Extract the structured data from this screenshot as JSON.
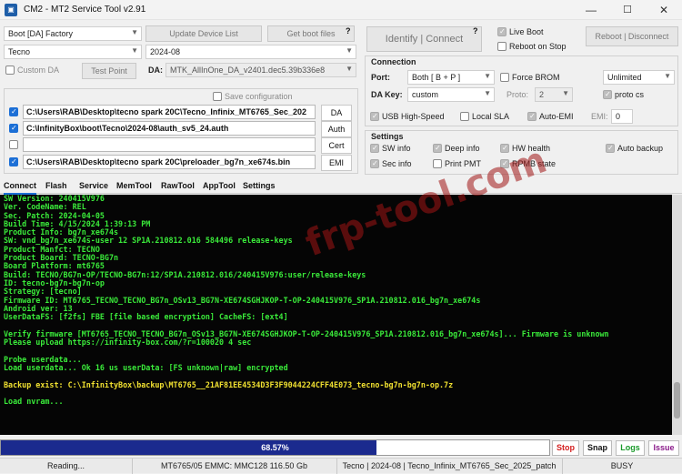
{
  "window": {
    "title": "CM2 - MT2 Service Tool v2.91",
    "min": "—",
    "max": "☐",
    "close": "✕"
  },
  "left": {
    "boot_combo": "Boot [DA] Factory",
    "brand_combo": "Tecno",
    "date_combo": "2024-08",
    "update_btn": "Update Device List",
    "bootfiles_btn": "Get boot files",
    "custom_da_label": "Custom DA",
    "test_point_btn": "Test Point",
    "da_label": "DA:",
    "da_value": "MTK_AllInOne_DA_v2401.dec5.39b336e8",
    "save_config_label": "Save configuration",
    "files": [
      {
        "path": "C:\\Users\\RAB\\Desktop\\tecno spark 20C\\Tecno_Infinix_MT6765_Sec_202",
        "button": "DA",
        "checked": true
      },
      {
        "path": "C:\\InfinityBox\\boot\\Tecno\\2024-08\\auth_sv5_24.auth",
        "button": "Auth",
        "checked": true
      },
      {
        "path": "",
        "button": "Cert",
        "checked": false
      },
      {
        "path": "C:\\Users\\RAB\\Desktop\\tecno spark 20C\\preloader_bg7n_xe674s.bin",
        "button": "EMI",
        "checked": true
      }
    ],
    "help": "?"
  },
  "right": {
    "identify": "Identify",
    "separator": "|",
    "connect": "Connect",
    "live_boot": "Live Boot",
    "reboot_on_stop": "Reboot on Stop",
    "reboot_disconnect": "Reboot | Disconnect",
    "help": "?",
    "connection": {
      "title": "Connection",
      "port_label": "Port:",
      "port_value": "Both [ B + P ]",
      "force_brom": "Force BROM",
      "speed_value": "Unlimited",
      "dakey_label": "DA Key:",
      "dakey_value": "custom",
      "proto_label": "Proto:",
      "proto_value": "2",
      "proto_cs": "proto cs",
      "usb_high_speed": "USB High-Speed",
      "local_sla": "Local SLA",
      "auto_emi": "Auto-EMI",
      "emi_label": "EMI:",
      "emi_value": "0"
    },
    "settings": {
      "title": "Settings",
      "sw_info": "SW info",
      "deep_info": "Deep info",
      "hw_health": "HW health",
      "auto_backup": "Auto backup",
      "sec_info": "Sec info",
      "print_pmt": "Print PMT",
      "rpmb_state": "RPMB state"
    }
  },
  "tabs": [
    "Connect",
    "Flash",
    "Service",
    "MemTool",
    "RawTool",
    "AppTool",
    "Settings"
  ],
  "console": [
    {
      "t": "  SW Version: 240415V976",
      "c": "g"
    },
    {
      "t": "  Ver. CodeName: REL",
      "c": "g"
    },
    {
      "t": "  Sec. Patch: 2024-04-05",
      "c": "g"
    },
    {
      "t": "  Build Time: 4/15/2024 1:39:13 PM",
      "c": "g"
    },
    {
      "t": "  Product Info: bg7n_xe674s",
      "c": "g"
    },
    {
      "t": "  SW: vnd_bg7n_xe674s-user 12 SP1A.210812.016 584496 release-keys",
      "c": "g"
    },
    {
      "t": "  Product Manfct: TECNO",
      "c": "g"
    },
    {
      "t": "  Product Board: TECNO-BG7n",
      "c": "g"
    },
    {
      "t": "  Board Platform: mt6765",
      "c": "g"
    },
    {
      "t": "  Build: TECNO/BG7n-OP/TECNO-BG7n:12/SP1A.210812.016/240415V976:user/release-keys",
      "c": "g"
    },
    {
      "t": "ID: tecno-bg7n-bg7n-op",
      "c": "g"
    },
    {
      "t": "Strategy: [tecno]",
      "c": "g"
    },
    {
      "t": "Firmware ID: MT6765_TECNO_TECNO_BG7n_OSv13_BG7N-XE674SGHJKOP-T-OP-240415V976_SP1A.210812.016_bg7n_xe674s",
      "c": "g"
    },
    {
      "t": "Android ver: 13",
      "c": "g"
    },
    {
      "t": "UserDataFS: [f2fs] FBE [file based encryption] CacheFS: [ext4]",
      "c": "g"
    },
    {
      "t": "",
      "c": "g"
    },
    {
      "t": "Verify firmware [MT6765_TECNO_TECNO_BG7n_OSv13_BG7N-XE674SGHJKOP-T-OP-240415V976_SP1A.210812.016_bg7n_xe674s]... Firmware is unknown",
      "c": "g"
    },
    {
      "t": "Please upload https://infinity-box.com/?r=100020 4 sec",
      "c": "g"
    },
    {
      "t": "",
      "c": "g"
    },
    {
      "t": "Probe userdata...",
      "c": "g"
    },
    {
      "t": "Load userdata... Ok 16 us userData: [FS unknown|raw] encrypted",
      "c": "g"
    },
    {
      "t": "",
      "c": "g"
    },
    {
      "t": "Backup exist: C:\\InfinityBox\\backup\\MT6765__21AF81EE4534D3F3F9044224CFF4E073_tecno-bg7n-bg7n-op.7z",
      "c": "y"
    },
    {
      "t": "",
      "c": "g"
    },
    {
      "t": "Load nvram...",
      "c": "g"
    }
  ],
  "watermark": "frp-tool.com",
  "progress": {
    "value": 0.6857,
    "label": "68.57%"
  },
  "actions": {
    "stop": "Stop",
    "snap": "Snap",
    "logs": "Logs",
    "issue": "Issue"
  },
  "status": {
    "state": "Reading...",
    "storage": "MT6765/05 EMMC: MMC128 116.50 Gb",
    "firmware": "Tecno | 2024-08 | Tecno_Infinix_MT6765_Sec_2025_patch",
    "busy": "BUSY"
  },
  "colors": {
    "console_green": "#3aea3a",
    "console_yellow": "#f0e030",
    "progress_fill": "#1b2a8e",
    "stop": "#d42020",
    "logs": "#1a9a2a",
    "issue": "#8a1a8a"
  }
}
